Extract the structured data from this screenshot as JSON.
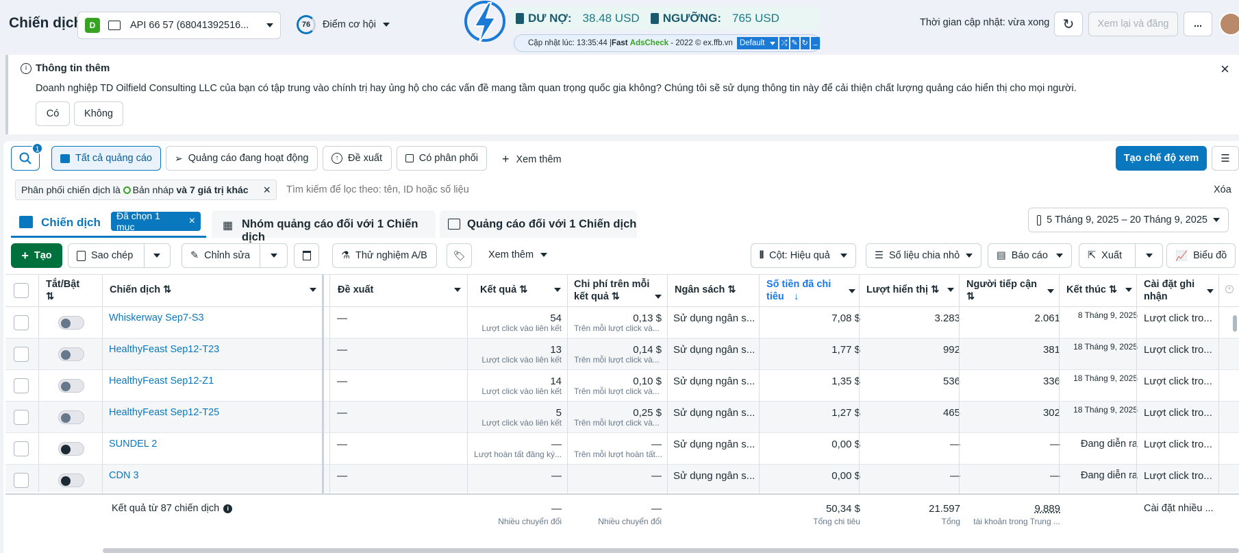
{
  "topbar": {
    "title": "Chiến dịch",
    "account_badge": "D",
    "account_name": "API 66 57 (68041392516...",
    "opportunity_score": "76",
    "opportunity_label": "Điểm cơ hội",
    "debt_label": "DƯ NỢ:",
    "debt_value": "38.48 USD",
    "threshold_label": "NGƯỠNG:",
    "threshold_value": "765 USD",
    "update_info_prefix": "Cập nhật lúc: 13:35:44 | ",
    "update_brand_fast": "Fast ",
    "update_brand_name": "AdsCheck",
    "update_info_suffix": " - 2022 © ex.ffb.vn",
    "profile_select": "Default",
    "update_time_text": "Thời gian cập nhật: vừa xong",
    "review_publish_label": "Xem lại và đăng",
    "more_label": "..."
  },
  "banner": {
    "title": "Thông tin thêm",
    "message": "Doanh nghiệp TD Oilfield Consulting LLC của bạn có tập trung vào chính trị hay ủng hộ cho các vấn đề mang tầm quan trọng quốc gia không? Chúng tôi sẽ sử dụng thông tin này để cải thiện chất lượng quảng cáo hiển thị cho mọi người.",
    "yes_label": "Có",
    "no_label": "Không"
  },
  "filters": {
    "search_badge": "1",
    "all_ads": "Tất cả quảng cáo",
    "active_ads": "Quảng cáo đang hoạt động",
    "suggested": "Đề xuất",
    "delivering": "Có phân phối",
    "see_more": "Xem thêm",
    "create_view": "Tạo chế độ xem",
    "filter_chip_prefix": "Phân phối chiến dịch là ",
    "filter_chip_value": "Bản nháp",
    "filter_chip_suffix": " và 7 giá trị khác",
    "search_placeholder": "Tìm kiếm để lọc theo: tên, ID hoặc số liệu",
    "clear_label": "Xóa"
  },
  "tabs": {
    "campaigns": "Chiến dịch",
    "selected_chip": "Đã chọn 1 mục",
    "adsets": "Nhóm quảng cáo đối với 1 Chiến dịch",
    "ads": "Quảng cáo đối với 1 Chiến dịch",
    "date_range": "5 Tháng 9, 2025 – 20 Tháng 9, 2025"
  },
  "toolbar": {
    "create": "Tạo",
    "duplicate": "Sao chép",
    "edit": "Chỉnh sửa",
    "ab_test": "Thử nghiệm A/B",
    "see_more": "Xem thêm",
    "columns": "Cột: Hiệu quả",
    "breakdown": "Số liệu chia nhỏ",
    "reports": "Báo cáo",
    "export": "Xuất",
    "chart": "Biểu đồ"
  },
  "table": {
    "headers": {
      "toggle": "Tắt/Bật",
      "campaign": "Chiến dịch",
      "recommendation": "Đề xuất",
      "results": "Kết quả",
      "cost_per_result": "Chi phí trên mỗi kết quả",
      "budget": "Ngân sách",
      "amount_spent": "Số tiền đã chi tiêu",
      "impressions": "Lượt hiển thị",
      "reach": "Người tiếp cận",
      "ends": "Kết thúc",
      "attribution": "Cài đặt ghi nhận"
    },
    "rows": [
      {
        "name": "Whiskerway Sep7-S3",
        "recommendation": "—",
        "results": "54",
        "results_sub": "Lượt click vào liên kết",
        "cpr": "0,13 $",
        "cpr_sub": "Trên mỗi lượt click và...",
        "budget": "Sử dụng ngân s...",
        "spent": "7,08 $",
        "impressions": "3.283",
        "reach": "2.061",
        "ends": "8 Tháng 9, 2025",
        "attribution": "Lượt click tro...",
        "toggle": "off"
      },
      {
        "name": "HealthyFeast Sep12-T23",
        "recommendation": "—",
        "results": "13",
        "results_sub": "Lượt click vào liên kết",
        "cpr": "0,14 $",
        "cpr_sub": "Trên mỗi lượt click và...",
        "budget": "Sử dụng ngân s...",
        "spent": "1,77 $",
        "impressions": "992",
        "reach": "381",
        "ends": "18 Tháng 9, 2025",
        "attribution": "Lượt click tro...",
        "toggle": "off"
      },
      {
        "name": "HealthyFeast Sep12-Z1",
        "recommendation": "—",
        "results": "14",
        "results_sub": "Lượt click vào liên kết",
        "cpr": "0,10 $",
        "cpr_sub": "Trên mỗi lượt click và...",
        "budget": "Sử dụng ngân s...",
        "spent": "1,35 $",
        "impressions": "536",
        "reach": "336",
        "ends": "18 Tháng 9, 2025",
        "attribution": "Lượt click tro...",
        "toggle": "off"
      },
      {
        "name": "HealthyFeast Sep12-T25",
        "recommendation": "—",
        "results": "5",
        "results_sub": "Lượt click vào liên kết",
        "cpr": "0,25 $",
        "cpr_sub": "Trên mỗi lượt click và...",
        "budget": "Sử dụng ngân s...",
        "spent": "1,27 $",
        "impressions": "465",
        "reach": "302",
        "ends": "18 Tháng 9, 2025",
        "attribution": "Lượt click tro...",
        "toggle": "off"
      },
      {
        "name": "SUNDEL 2",
        "recommendation": "—",
        "results": "—",
        "results_sub": "Lượt hoàn tất đăng ký...",
        "cpr": "—",
        "cpr_sub": "Trên mỗi lượt hoàn tất...",
        "budget": "Sử dụng ngân s...",
        "spent": "0,00 $",
        "impressions": "—",
        "reach": "—",
        "ends": "Đang diễn ra",
        "attribution": "Lượt click tro...",
        "toggle": "on"
      },
      {
        "name": "CDN 3",
        "recommendation": "—",
        "results": "—",
        "results_sub": "",
        "cpr": "—",
        "cpr_sub": "",
        "budget": "Sử dụng ngân s...",
        "spent": "0,00 $",
        "impressions": "—",
        "reach": "—",
        "ends": "Đang diễn ra",
        "attribution": "Lượt click tro...",
        "toggle": "on"
      }
    ],
    "footer": {
      "label": "Kết quả từ 87 chiến dịch",
      "results": "—",
      "results_sub": "Nhiều chuyển đổi",
      "cpr": "—",
      "cpr_sub": "Nhiều chuyển đổi",
      "spent": "50,34 $",
      "spent_sub": "Tổng chi tiêu",
      "impressions": "21.597",
      "impressions_sub": "Tổng",
      "reach": "9.889",
      "reach_sub": "tài khoản trong Trung ...",
      "attribution": "Cài đặt nhiều ..."
    }
  },
  "colors": {
    "accent": "#0a78be",
    "create_green": "#00703c",
    "header_blue": "#1877f2"
  }
}
